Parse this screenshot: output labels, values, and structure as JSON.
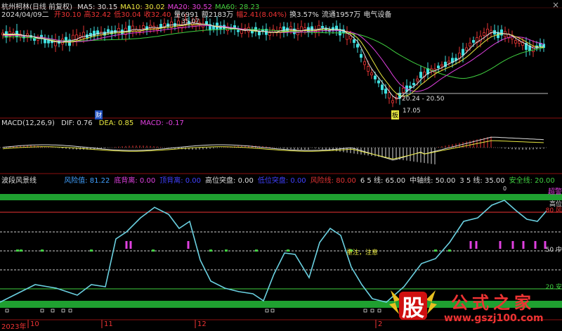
{
  "header": {
    "stock": "杭州柯林(日线 前复权)",
    "ma": [
      {
        "label": "MA5: 30.15",
        "color": "#e0e0e0"
      },
      {
        "label": "MA10: 30.02",
        "color": "#e8e840"
      },
      {
        "label": "MA20: 30.52",
        "color": "#e040e0"
      },
      {
        "label": "MA60: 28.23",
        "color": "#40d040"
      }
    ],
    "date": "2024/04/09二",
    "ohlc": [
      {
        "label": "开30.10",
        "color": "#e33"
      },
      {
        "label": "高32.42",
        "color": "#e33"
      },
      {
        "label": "低30.04",
        "color": "#e33"
      },
      {
        "label": "收32.40",
        "color": "#e33"
      },
      {
        "label": "量6991",
        "color": "#ddd"
      },
      {
        "label": "额2183万",
        "color": "#ddd"
      },
      {
        "label": "幅2.41(8.04%)",
        "color": "#e33"
      },
      {
        "label": "换3.57%",
        "color": "#ddd"
      },
      {
        "label": "流通1957万",
        "color": "#ddd"
      },
      {
        "label": "电气设备",
        "color": "#ddd"
      }
    ]
  },
  "price_annotations": {
    "high_price": "35.07",
    "range_label": "20.24 - 20.50",
    "low_price": "17.05",
    "cai_marker": "财",
    "ban_marker": "板"
  },
  "macd": {
    "params": "MACD(12,26,9)",
    "dif": "DIF: 0.76",
    "dea": "DEA: 0.85",
    "macd": "MACD: -0.17"
  },
  "wave": {
    "name": "波段风景线",
    "fields": [
      {
        "label": "风险值: 81.22",
        "color": "#40a0ff"
      },
      {
        "label": "底背离: 0.00",
        "color": "#e040e0"
      },
      {
        "label": "顶背离: 0.00",
        "color": "#4040ff"
      },
      {
        "label": "高位突盘: 0.00",
        "color": "#dddddd"
      },
      {
        "label": "低位突盘: 0.00",
        "color": "#4040ff"
      },
      {
        "label": "风险线: 80.00",
        "color": "#e33333"
      },
      {
        "label": "6 5 线: 65.00",
        "color": "#dddddd"
      },
      {
        "label": "中轴线: 50.00",
        "color": "#dddddd"
      },
      {
        "label": "3 5 线: 35.00",
        "color": "#dddddd"
      },
      {
        "label": "安全线: 20.00",
        "color": "#40d040"
      }
    ],
    "right_labels": [
      "超警",
      "高位",
      "80 风",
      "50 中",
      "20 安"
    ],
    "note_a": "重注，注意",
    "note_b": "0"
  },
  "dates": {
    "year": "2023年",
    "m10": "10",
    "m11": "11",
    "m12": "12",
    "m2": "2"
  },
  "watermark": {
    "big": "股",
    "title": "公式之家",
    "url": "www.gszj100.com"
  },
  "window": {
    "close_label": "×"
  },
  "colors": {
    "up": "#e33333",
    "down": "#40e0e0",
    "ma5": "#e0e0e0",
    "ma10": "#e8e840",
    "ma20": "#e040e0",
    "ma60": "#40d040",
    "wave": "#6ad0e0",
    "band": "#1fa030"
  }
}
